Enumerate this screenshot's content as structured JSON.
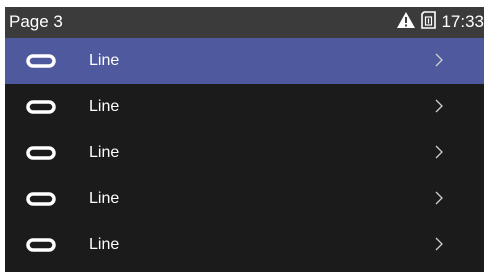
{
  "status_bar": {
    "title": "Page 3",
    "time": "17:33",
    "icons": [
      "warning-icon",
      "sim-card-icon"
    ]
  },
  "list": {
    "items": [
      {
        "label": "Line",
        "icon": "line-icon",
        "selected": true
      },
      {
        "label": "Line",
        "icon": "line-icon",
        "selected": false
      },
      {
        "label": "Line",
        "icon": "line-icon",
        "selected": false
      },
      {
        "label": "Line",
        "icon": "line-icon",
        "selected": false
      },
      {
        "label": "Line",
        "icon": "line-icon",
        "selected": false
      }
    ]
  },
  "colors": {
    "background": "#1b1b1b",
    "status_bar": "#3b3b3b",
    "selected_row": "#4f5a9e",
    "text": "#ffffff"
  }
}
